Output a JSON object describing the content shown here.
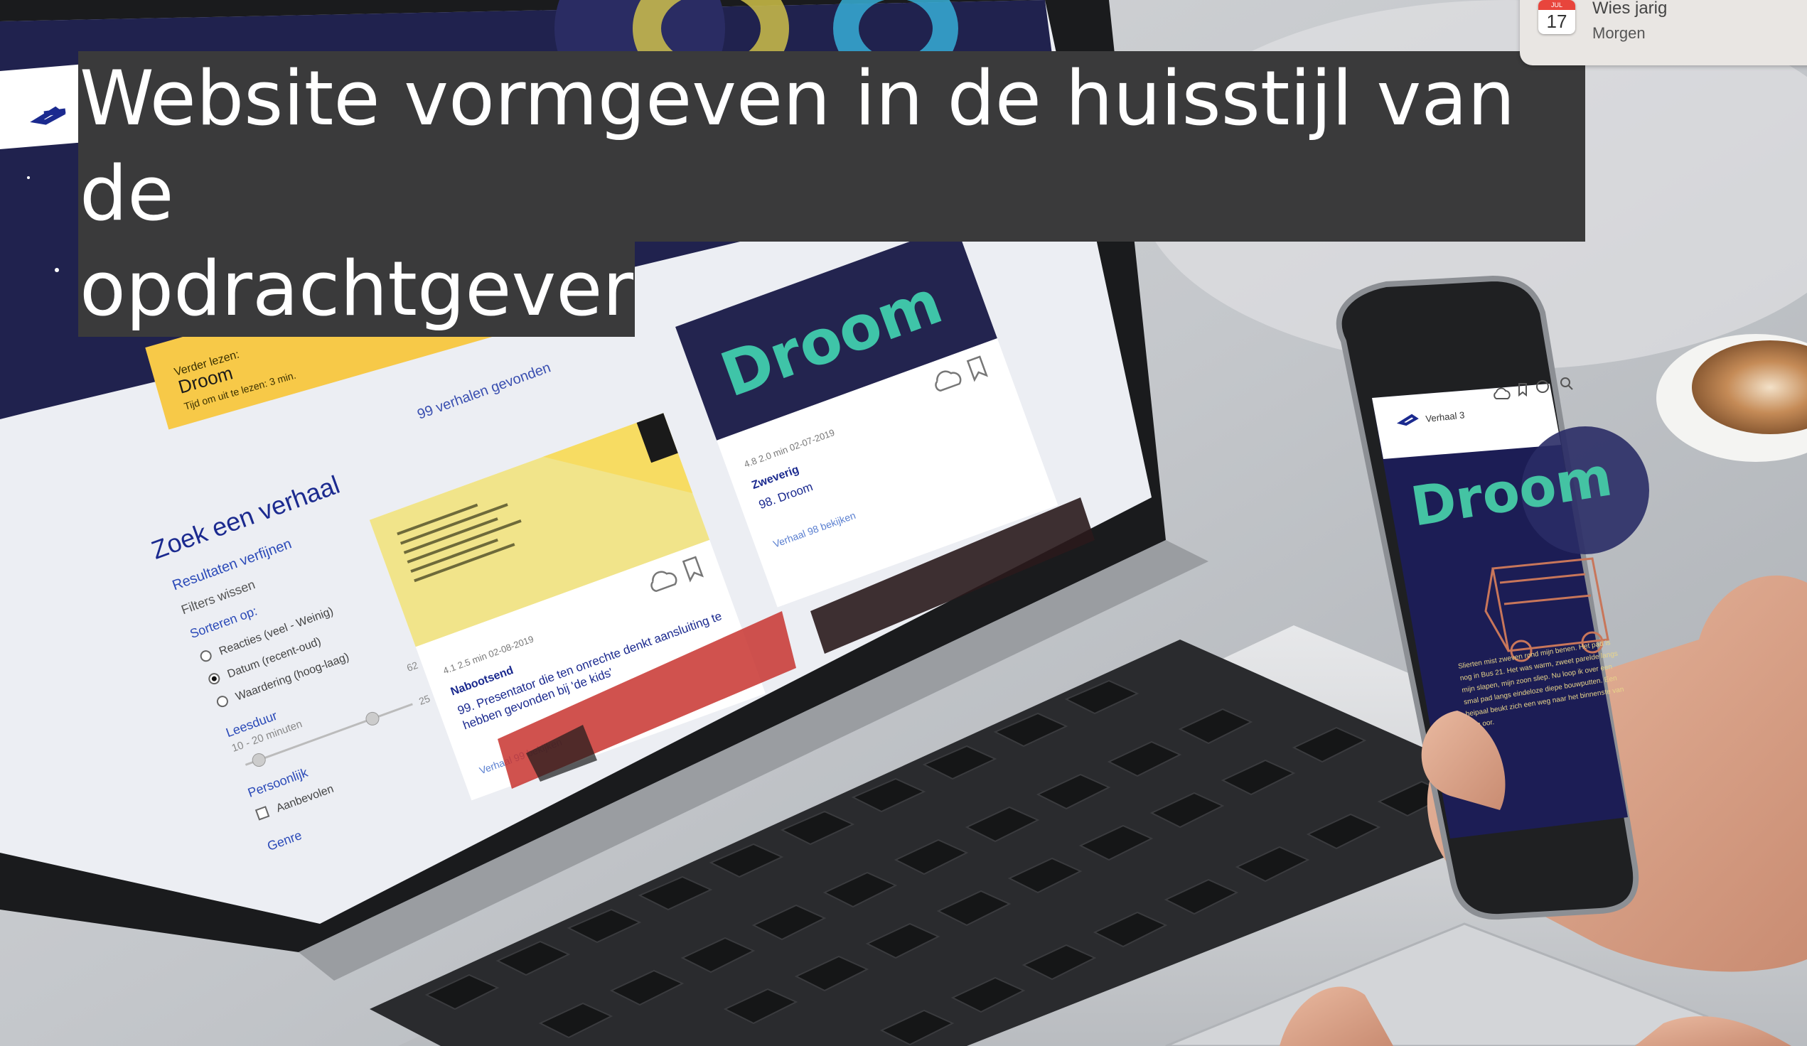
{
  "headline": {
    "line1": "Website vormgeven in de huisstijl van de",
    "line2": "opdrachtgever"
  },
  "notification": {
    "icon": "calendar-icon",
    "cal_month": "JUL",
    "cal_day": "17",
    "title": "Wies jarig",
    "subtitle": "Morgen"
  },
  "laptop_screen": {
    "banner_label": "Verder lezen:",
    "banner_title": "Droom",
    "banner_time": "Tijd om uit te lezen: 3 min.",
    "results_count": "99 verhalen gevonden",
    "sidebar_title": "Zoek een verhaal",
    "refine": "Resultaten verfijnen",
    "clear_filters": "Filters wissen",
    "sort_label": "Sorteren op:",
    "sort_options": [
      "Reacties (veel - Weinig)",
      "Datum (recent-oud)",
      "Waardering (hoog-laag)"
    ],
    "reading_time_label": "Leesduur",
    "reading_time_range": "10 - 20 minuten",
    "slider_max": "62",
    "slider_min": "25",
    "personal_label": "Persoonlijk",
    "recommended_label": "Aanbevolen",
    "genre_label": "Genre",
    "card1_meta": "4.1   2.5 min   02-08-2019",
    "card1_tag": "Nabootsend",
    "card1_title": "99. Presentator die ten onrechte denkt aansluiting te hebben gevonden bij 'de kids'",
    "card1_link": "Verhaal 99 bekijken",
    "card2_logo": "Droom",
    "card2_meta": "4.8   2.0 min   02-07-2019",
    "card2_tag": "Zweverig",
    "card2_title": "98. Droom",
    "card2_link": "Verhaal 98 bekijken"
  },
  "phone_screen": {
    "nav_title": "Verhaal 3",
    "logo": "Droom",
    "body": "Slierten mist zweven rond mijn benen. Het pad is nog in Bus 21. Het was warm, zweet parelde langs mijn slapen, mijn zoon sliep. Nu loop ik over een smal pad langs eindeloze diepe bouwputten. Een heipaal beukt zich een weg naar het binnenste van mijn oor."
  },
  "colors": {
    "headline_bg": "#3a3a3b",
    "banner_yellow": "#f7c948",
    "ns_blue": "#1b2a8f",
    "droom_bg": "#1c1d4d"
  }
}
